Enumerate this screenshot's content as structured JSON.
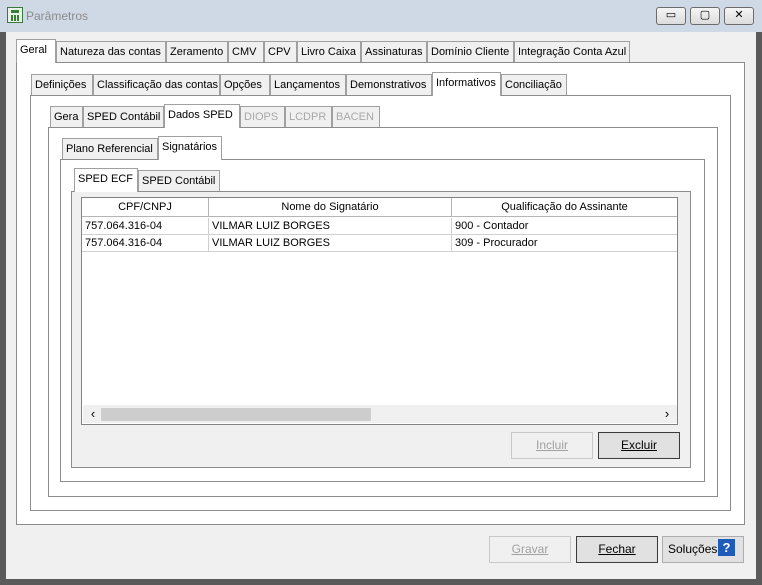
{
  "window": {
    "title": "Parâmetros",
    "controls": {
      "minimize": "▭",
      "maximize": "▢",
      "close": "✕"
    }
  },
  "main_tabs": [
    {
      "label": "Geral",
      "active": true
    },
    {
      "label": "Natureza das contas"
    },
    {
      "label": "Zeramento"
    },
    {
      "label": "CMV"
    },
    {
      "label": "CPV"
    },
    {
      "label": "Livro Caixa"
    },
    {
      "label": "Assinaturas"
    },
    {
      "label": "Domínio Cliente"
    },
    {
      "label": "Integração Conta Azul"
    }
  ],
  "sub_tabs": [
    {
      "label": "Definições"
    },
    {
      "label": "Classificação das contas"
    },
    {
      "label": "Opções"
    },
    {
      "label": "Lançamentos"
    },
    {
      "label": "Demonstrativos"
    },
    {
      "label": "Informativos",
      "active": true
    },
    {
      "label": "Conciliação"
    }
  ],
  "info_tabs": [
    {
      "label": "Gera"
    },
    {
      "label": "SPED Contábil"
    },
    {
      "label": "Dados SPED",
      "active": true
    },
    {
      "label": "DIOPS",
      "disabled": true
    },
    {
      "label": "LCDPR",
      "disabled": true
    },
    {
      "label": "BACEN",
      "disabled": true
    }
  ],
  "sped_tabs": [
    {
      "label": "Plano Referencial"
    },
    {
      "label": "Signatários",
      "active": true
    }
  ],
  "sign_tabs": [
    {
      "label": "SPED ECF",
      "active": true
    },
    {
      "label": "SPED Contábil"
    }
  ],
  "grid": {
    "columns": [
      "CPF/CNPJ",
      "Nome do Signatário",
      "Qualificação do Assinante"
    ],
    "rows": [
      [
        "757.064.316-04",
        "VILMAR LUIZ BORGES",
        "900 - Contador"
      ],
      [
        "757.064.316-04",
        "VILMAR LUIZ BORGES",
        "309 - Procurador"
      ]
    ]
  },
  "scroll": {
    "left": "‹",
    "right": "›"
  },
  "grid_buttons": {
    "incluir": "Incluir",
    "excluir": "Excluir"
  },
  "footer_buttons": {
    "gravar": "Gravar",
    "fechar": "Fechar",
    "solucoes": "Soluções",
    "help": "?"
  }
}
